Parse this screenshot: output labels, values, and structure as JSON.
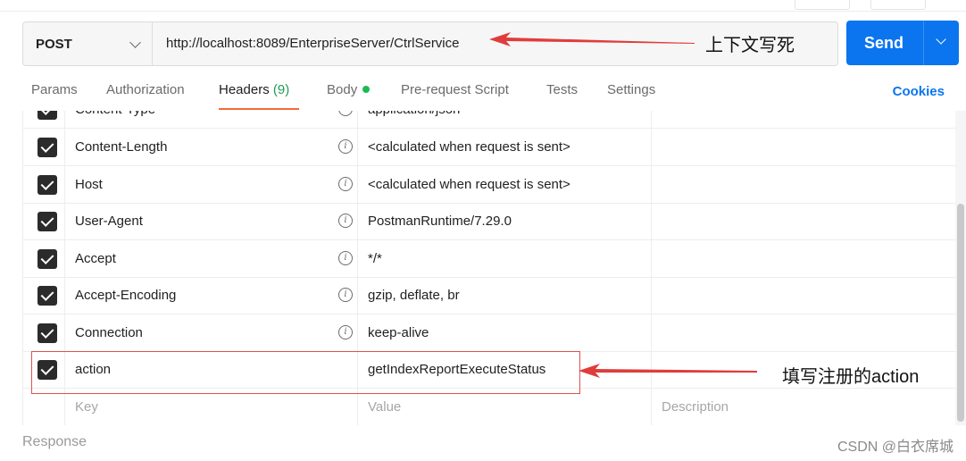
{
  "request": {
    "method": "POST",
    "url": "http://localhost:8089/EnterpriseServer/CtrlService",
    "send_label": "Send"
  },
  "annotations": {
    "url_note": "上下文写死",
    "action_note": "填写注册的action"
  },
  "tabs": [
    {
      "label": "Params"
    },
    {
      "label": "Authorization"
    },
    {
      "label": "Headers",
      "count": "(9)",
      "active": true
    },
    {
      "label": "Body",
      "indicator": "green-dot"
    },
    {
      "label": "Pre-request Script"
    },
    {
      "label": "Tests"
    },
    {
      "label": "Settings"
    }
  ],
  "cookies_label": "Cookies",
  "headers": [
    {
      "key": "Content-Type",
      "value": "application/json",
      "checked": true,
      "info": true
    },
    {
      "key": "Content-Length",
      "value": "<calculated when request is sent>",
      "checked": true,
      "info": true
    },
    {
      "key": "Host",
      "value": "<calculated when request is sent>",
      "checked": true,
      "info": true
    },
    {
      "key": "User-Agent",
      "value": "PostmanRuntime/7.29.0",
      "checked": true,
      "info": true
    },
    {
      "key": "Accept",
      "value": "*/*",
      "checked": true,
      "info": true
    },
    {
      "key": "Accept-Encoding",
      "value": "gzip, deflate, br",
      "checked": true,
      "info": true
    },
    {
      "key": "Connection",
      "value": "keep-alive",
      "checked": true,
      "info": true
    },
    {
      "key": "action",
      "value": "getIndexReportExecuteStatus",
      "checked": true,
      "info": false
    }
  ],
  "new_row": {
    "key_placeholder": "Key",
    "value_placeholder": "Value",
    "description_placeholder": "Description"
  },
  "info_glyph": "i",
  "response_label": "Response",
  "watermark": "CSDN @白衣席城",
  "colors": {
    "accent": "#0b75ef",
    "active_tab_underline": "#f26b3a",
    "body_dot": "#1db954",
    "annotation_red": "#e03c3c"
  }
}
